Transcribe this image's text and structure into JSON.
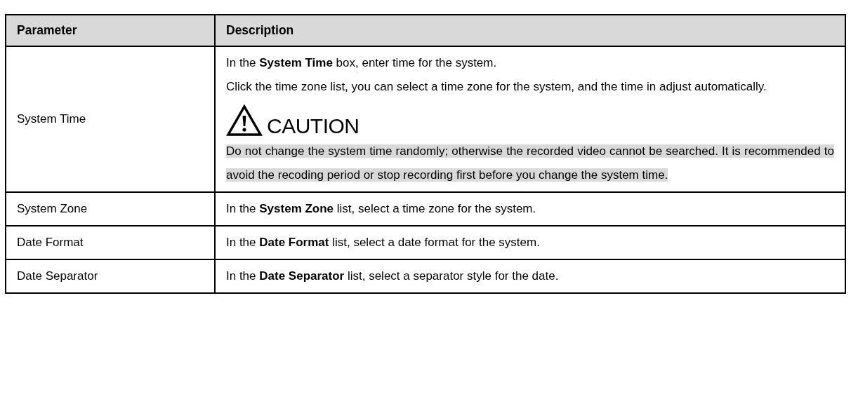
{
  "table": {
    "columns": [
      "Parameter",
      "Description"
    ],
    "rows": [
      {
        "parameter": "System Time",
        "description": [
          "In the **System Time** box, enter time for the system.",
          "Click the time zone list, you can select a time zone for the system, and the time in adjust automatically."
        ],
        "caution": {
          "label": "CAUTION",
          "text": "Do not change the system time randomly; otherwise the recorded video cannot be searched. It is recommended to avoid the recoding period or stop recording first before you change the system time."
        }
      },
      {
        "parameter": "System Zone",
        "description": [
          "In the **System Zone** list, select a time zone for the system."
        ]
      },
      {
        "parameter": "Date Format",
        "description": [
          "In the **Date Format** list, select a date format for the system."
        ]
      },
      {
        "parameter": "Date Separator",
        "description": [
          "In the **Date Separator** list, select a separator style for the date."
        ]
      }
    ]
  }
}
